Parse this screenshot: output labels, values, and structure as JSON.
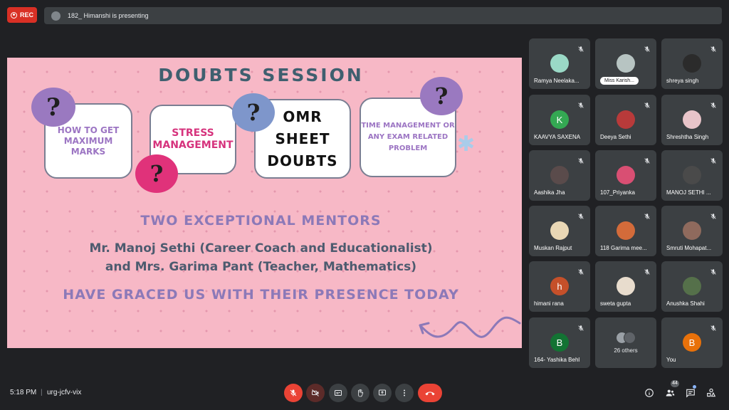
{
  "recording": {
    "label": "REC",
    "color": "#d93025"
  },
  "presenting": {
    "text": "182_ Himanshi is presenting"
  },
  "slide": {
    "title": "DOUBTS SESSION",
    "cards": [
      "HOW TO GET MAXIMUM MARKS",
      "STRESS MANAGEMENT",
      "OMR SHEET DOUBTS",
      "TIME MANAGEMENT OR ANY EXAM RELATED PROBLEM"
    ],
    "question_mark": "?",
    "mentors_heading": "TWO EXCEPTIONAL MENTORS",
    "mentor_line_1": "Mr. Manoj Sethi (Career Coach and Educationalist)",
    "mentor_line_2": "and Mrs. Garima Pant (Teacher, Mathematics)",
    "closing": "HAVE GRACED US WITH THEIR PRESENCE TODAY"
  },
  "participants": [
    {
      "name": "Ramya Neelaka...",
      "avatar_color": "#9ad9c6"
    },
    {
      "name": "Miss Karish...",
      "avatar_color": "#b7c4c2",
      "pinned": true
    },
    {
      "name": "shreya singh",
      "avatar_color": "#2b2b2b"
    },
    {
      "name": "KAAVYA SAXENA",
      "initial": "K",
      "avatar_color": "#34a853"
    },
    {
      "name": "Deeya Sethi",
      "avatar_color": "#b83a3a"
    },
    {
      "name": "Shreshtha Singh",
      "avatar_color": "#e8c4c9"
    },
    {
      "name": "Aashika Jha",
      "avatar_color": "#5a4b4b"
    },
    {
      "name": "107_Priyanka",
      "avatar_color": "#d94f73"
    },
    {
      "name": "MANOJ SETHI ...",
      "avatar_color": "#4a4a4a"
    },
    {
      "name": "Muskan Rajput",
      "avatar_color": "#e9d7b5"
    },
    {
      "name": "118 Garima mee...",
      "avatar_color": "#d36b3a"
    },
    {
      "name": "Smruti Mohapat...",
      "avatar_color": "#8f6a5d"
    },
    {
      "name": "himani rana",
      "initial": "h",
      "avatar_color": "#c5502a"
    },
    {
      "name": "sweta gupta",
      "avatar_color": "#e8dccd"
    },
    {
      "name": "Anushka Shahi",
      "avatar_color": "#55704a"
    },
    {
      "name": "164- Yashika Behl",
      "initial": "B",
      "avatar_color": "#137333"
    },
    {
      "name": "26 others",
      "others": true
    },
    {
      "name": "You",
      "initial": "B",
      "avatar_color": "#e8710a"
    }
  ],
  "footer": {
    "time": "5:18 PM",
    "separator": "|",
    "meeting_code": "urg-jcfv-vix",
    "participant_count": "44"
  },
  "controls": [
    "mic-off",
    "camera-off",
    "captions",
    "raise-hand",
    "present",
    "more",
    "end-call"
  ]
}
